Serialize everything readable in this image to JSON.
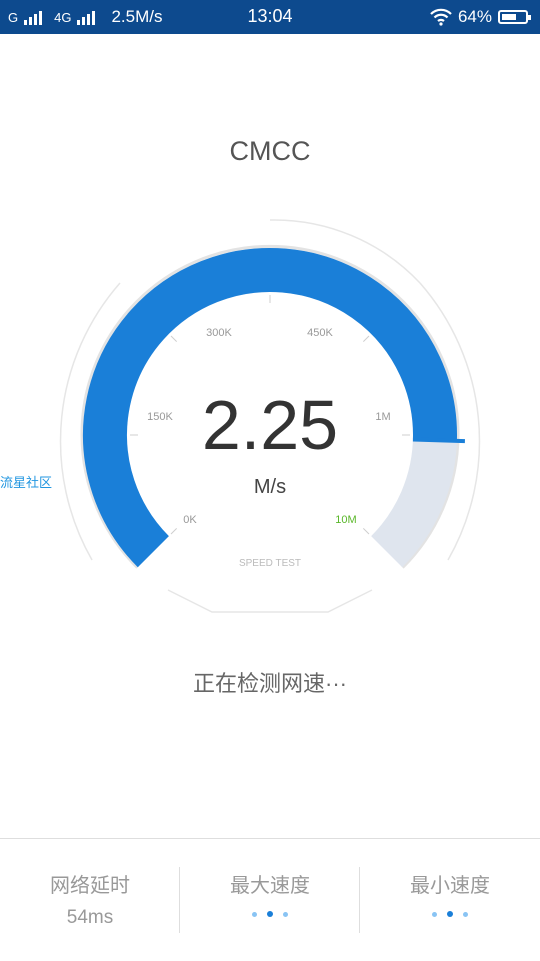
{
  "status_bar": {
    "carrier1": "G",
    "carrier2": "4G",
    "net_speed": "2.5M/s",
    "time": "13:04",
    "battery_text": "64%",
    "battery_level": 0.64
  },
  "operator": "CMCC",
  "gauge": {
    "speed_value": "2.25",
    "speed_unit": "M/s",
    "ticks": [
      "0K",
      "150K",
      "300K",
      "450K",
      "1M",
      "10M"
    ],
    "footer": "SPEED TEST",
    "fill_fraction": 0.84,
    "colors": {
      "active": "#1a7fd8",
      "inactive": "#dfe5ee",
      "max_tick": "#5ab72a"
    }
  },
  "side_label": "流星社区",
  "status_text": "正在检测网速···",
  "stats": {
    "latency": {
      "label": "网络延时",
      "value": "54ms"
    },
    "max_speed": {
      "label": "最大速度"
    },
    "min_speed": {
      "label": "最小速度"
    }
  }
}
